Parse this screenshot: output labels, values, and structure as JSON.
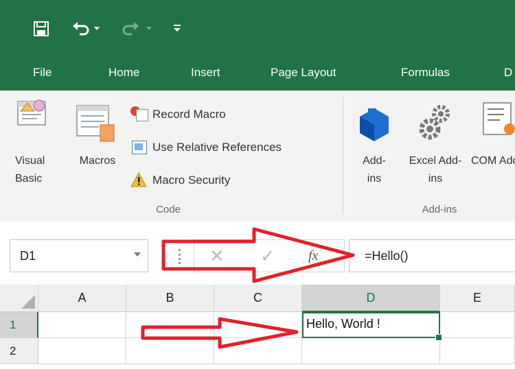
{
  "qat": {
    "icons": [
      "save-icon",
      "undo-icon",
      "redo-icon",
      "customize-qat-icon"
    ]
  },
  "tabs": [
    "File",
    "Home",
    "Insert",
    "Page Layout",
    "Formulas",
    "D"
  ],
  "ribbon": {
    "code_group": {
      "visual_basic": "Visual Basic",
      "macros": "Macros",
      "record_macro": "Record Macro",
      "use_relative_references": "Use Relative References",
      "macro_security": "Macro Security",
      "label": "Code"
    },
    "addins_group": {
      "addins": "Add-ins",
      "excel_addins": "Excel Add-ins",
      "com_addins": "COM Add-i",
      "label": "Add-ins"
    }
  },
  "formula_bar": {
    "name_box": "D1",
    "fx": "fx",
    "formula": "=Hello()"
  },
  "sheet": {
    "columns": [
      "A",
      "B",
      "C",
      "D",
      "E"
    ],
    "rows": [
      "1",
      "2"
    ],
    "active_cell_value": "Hello, World !"
  },
  "colors": {
    "excel_green": "#217346",
    "annotation_red": "#e3202b"
  }
}
